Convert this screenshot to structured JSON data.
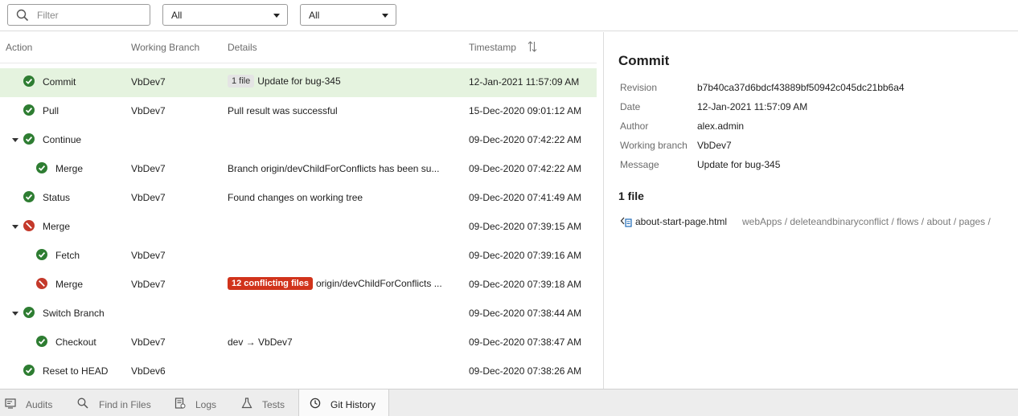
{
  "toolbar": {
    "filter_placeholder": "Filter",
    "select_one": "All",
    "select_two": "All"
  },
  "columns": {
    "action": "Action",
    "branch": "Working Branch",
    "details": "Details",
    "timestamp": "Timestamp"
  },
  "rows": [
    {
      "action": "Commit",
      "status": "success",
      "indent": 0,
      "expander": false,
      "branch": "VbDev7",
      "badge": "1 file",
      "badge_style": "grey",
      "details": "Update for bug-345",
      "timestamp": "12-Jan-2021 11:57:09 AM",
      "selected": true
    },
    {
      "action": "Pull",
      "status": "success",
      "indent": 0,
      "expander": false,
      "branch": "VbDev7",
      "badge": "",
      "badge_style": "",
      "details": "Pull result was successful",
      "timestamp": "15-Dec-2020 09:01:12 AM",
      "selected": false
    },
    {
      "action": "Continue",
      "status": "success",
      "indent": 0,
      "expander": true,
      "branch": "",
      "badge": "",
      "badge_style": "",
      "details": "",
      "timestamp": "09-Dec-2020 07:42:22 AM",
      "selected": false
    },
    {
      "action": "Merge",
      "status": "success",
      "indent": 1,
      "expander": false,
      "branch": "VbDev7",
      "badge": "",
      "badge_style": "",
      "details": "Branch origin/devChildForConflicts has been su...",
      "timestamp": "09-Dec-2020 07:42:22 AM",
      "selected": false
    },
    {
      "action": "Status",
      "status": "success",
      "indent": 0,
      "expander": false,
      "branch": "VbDev7",
      "badge": "",
      "badge_style": "",
      "details": "Found changes on working tree",
      "timestamp": "09-Dec-2020 07:41:49 AM",
      "selected": false
    },
    {
      "action": "Merge",
      "status": "error",
      "indent": 0,
      "expander": true,
      "branch": "",
      "badge": "",
      "badge_style": "",
      "details": "",
      "timestamp": "09-Dec-2020 07:39:15 AM",
      "selected": false
    },
    {
      "action": "Fetch",
      "status": "success",
      "indent": 1,
      "expander": false,
      "branch": "VbDev7",
      "badge": "",
      "badge_style": "",
      "details": "",
      "timestamp": "09-Dec-2020 07:39:16 AM",
      "selected": false
    },
    {
      "action": "Merge",
      "status": "error",
      "indent": 1,
      "expander": false,
      "branch": "VbDev7",
      "badge": "12 conflicting files",
      "badge_style": "red",
      "details": "origin/devChildForConflicts ...",
      "timestamp": "09-Dec-2020 07:39:18 AM",
      "selected": false
    },
    {
      "action": "Switch Branch",
      "status": "success",
      "indent": 0,
      "expander": true,
      "branch": "",
      "badge": "",
      "badge_style": "",
      "details": "",
      "timestamp": "09-Dec-2020 07:38:44 AM",
      "selected": false
    },
    {
      "action": "Checkout",
      "status": "success",
      "indent": 1,
      "expander": false,
      "branch": "VbDev7",
      "badge": "",
      "badge_style": "",
      "details": "dev → VbDev7",
      "timestamp": "09-Dec-2020 07:38:47 AM",
      "selected": false
    },
    {
      "action": "Reset to HEAD",
      "status": "success",
      "indent": 0,
      "expander": false,
      "branch": "VbDev6",
      "badge": "",
      "badge_style": "",
      "details": "",
      "timestamp": "09-Dec-2020 07:38:26 AM",
      "selected": false
    }
  ],
  "detail": {
    "title": "Commit",
    "fields": [
      {
        "label": "Revision",
        "value": "b7b40ca37d6bdcf43889bf50942c045dc21bb6a4"
      },
      {
        "label": "Date",
        "value": "12-Jan-2021 11:57:09 AM"
      },
      {
        "label": "Author",
        "value": "alex.admin"
      },
      {
        "label": "Working branch",
        "value": "VbDev7"
      },
      {
        "label": "Message",
        "value": "Update for bug-345"
      }
    ],
    "files_title": "1 file",
    "file_name": "about-start-page.html",
    "file_path": "webApps / deleteandbinaryconflict / flows / about / pages /"
  },
  "bottom_tabs": [
    {
      "label": "Audits",
      "icon": "audits-icon",
      "active": false
    },
    {
      "label": "Find in Files",
      "icon": "search-icon",
      "active": false
    },
    {
      "label": "Logs",
      "icon": "logs-icon",
      "active": false
    },
    {
      "label": "Tests",
      "icon": "flask-icon",
      "active": false
    },
    {
      "label": "Git History",
      "icon": "clock-icon",
      "active": true
    }
  ],
  "colors": {
    "success": "#2e7d32",
    "error": "#c4392b",
    "selected_row": "#e5f3df",
    "conflict_badge": "#d1331b"
  }
}
